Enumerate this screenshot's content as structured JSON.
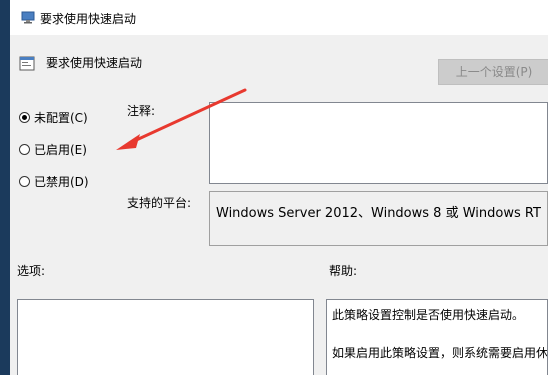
{
  "window": {
    "title": "要求使用快速启动"
  },
  "header": {
    "policy_title": "要求使用快速启动",
    "prev_button": "上一个设置(P)"
  },
  "state_options": [
    {
      "label": "未配置(C)",
      "checked": true
    },
    {
      "label": "已启用(E)",
      "checked": false
    },
    {
      "label": "已禁用(D)",
      "checked": false
    }
  ],
  "labels": {
    "comment": "注释:",
    "platform": "支持的平台:",
    "options": "选项:",
    "help": "帮助:"
  },
  "platform_value": "Windows Server 2012、Windows 8 或 Windows RT",
  "help_text": [
    "此策略设置控制是否使用快速启动。",
    "如果启用此策略设置，则系统需要启用休眠。"
  ],
  "colors": {
    "annotation_arrow": "#e8392f",
    "titlebar": "#ffffff",
    "dialog_bg": "#f0f0f0"
  }
}
